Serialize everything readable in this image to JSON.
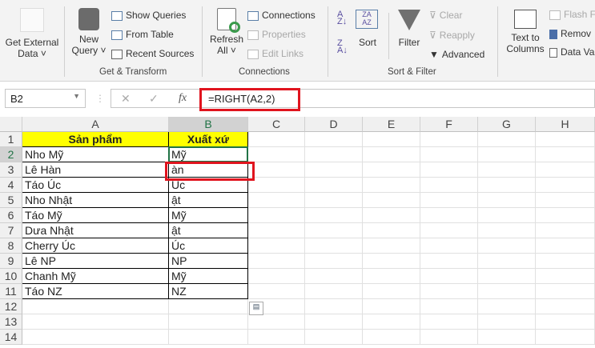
{
  "ribbon": {
    "get_external_data": [
      "Get External",
      "Data ˅"
    ],
    "new_query": [
      "New",
      "Query ˅"
    ],
    "show_queries": "Show Queries",
    "from_table": "From Table",
    "recent_sources": "Recent Sources",
    "group_get_transform": "Get & Transform",
    "refresh_all": [
      "Refresh",
      "All ˅"
    ],
    "connections": "Connections",
    "properties": "Properties",
    "edit_links": "Edit Links",
    "group_connections": "Connections",
    "sort": "Sort",
    "filter": "Filter",
    "clear": "Clear",
    "reapply": "Reapply",
    "advanced": "Advanced",
    "group_sort_filter": "Sort & Filter",
    "text_to_columns": [
      "Text to",
      "Columns"
    ],
    "flash_fill": "Flash Fi",
    "remove_duplicates": "Remov",
    "data_validation": "Data Va"
  },
  "formula_bar": {
    "name_box": "B2",
    "fx": "fx",
    "formula": "=RIGHT(A2,2)"
  },
  "columns": [
    "A",
    "B",
    "C",
    "D",
    "E",
    "F",
    "G",
    "H"
  ],
  "rows": [
    "1",
    "2",
    "3",
    "4",
    "5",
    "6",
    "7",
    "8",
    "9",
    "10",
    "11",
    "12",
    "13",
    "14"
  ],
  "table": {
    "headers": [
      "Sản phẩm",
      "Xuất xứ"
    ],
    "data": [
      [
        "Nho Mỹ",
        "Mỹ"
      ],
      [
        "Lê Hàn",
        "àn"
      ],
      [
        "Táo Úc",
        "Úc"
      ],
      [
        "Nho Nhật",
        "ật"
      ],
      [
        "Táo Mỹ",
        "Mỹ"
      ],
      [
        "Dưa Nhật",
        "ật"
      ],
      [
        "Cherry Úc",
        "Úc"
      ],
      [
        "Lê NP",
        "NP"
      ],
      [
        "Chanh Mỹ",
        "Mỹ"
      ],
      [
        "Táo NZ",
        "NZ"
      ]
    ]
  },
  "colors": {
    "highlight": "#e0141e",
    "header_fill": "#ffff00",
    "selection": "#217346"
  }
}
